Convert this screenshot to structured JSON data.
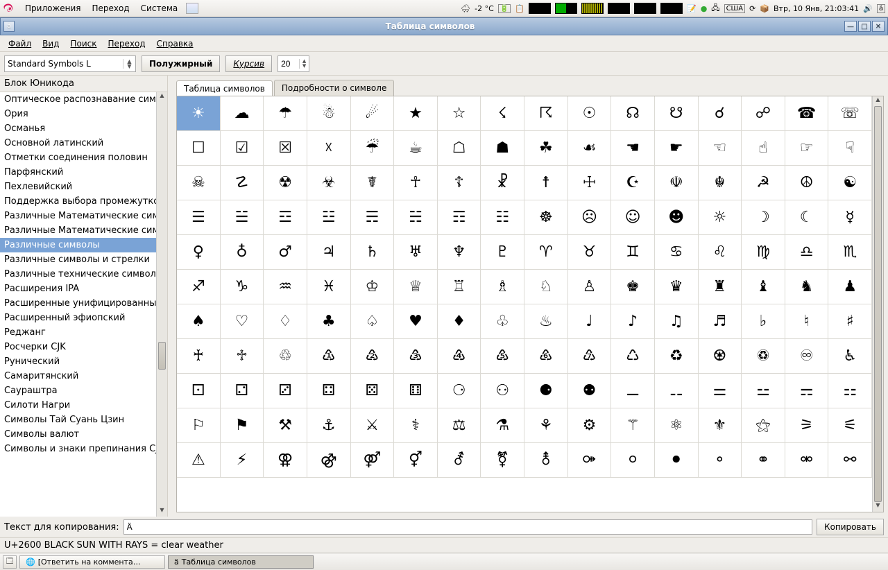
{
  "system_panel": {
    "menus": [
      "Приложения",
      "Переход",
      "Система"
    ],
    "weather": "-2 °C",
    "kbd_layout": "США",
    "clock": "Втр, 10 Янв, 21:03:41"
  },
  "window": {
    "title": "Таблица символов"
  },
  "menubar": {
    "items": [
      "Файл",
      "Вид",
      "Поиск",
      "Переход",
      "Справка"
    ]
  },
  "toolbar": {
    "font_family": "Standard Symbols L",
    "bold_label": "Полужирный",
    "italic_label": "Курсив",
    "size": "20"
  },
  "sidebar": {
    "header": "Блок Юникода",
    "items": [
      "Оптическое распознавание сим",
      "Ория",
      "Османья",
      "Основной латинский",
      "Отметки соединения половин",
      "Парфянский",
      "Пехлевийский",
      "Поддержка выбора промежутко",
      "Различные Математические сим",
      "Различные Математические сим",
      "Различные символы",
      "Различные символы и стрелки",
      "Различные технические символ",
      "Расширения IPA",
      "Расширенные унифицированные",
      "Расширенный эфиопский",
      "Реджанг",
      "Росчерки CJK",
      "Рунический",
      "Самаритянский",
      "Саураштра",
      "Силоти Нагри",
      "Символы Тай Суань Цзин",
      "Символы валют",
      "Символы и знаки препинания CJK"
    ],
    "selected_index": 10
  },
  "tabs": {
    "items": [
      "Таблица символов",
      "Подробности о символе"
    ],
    "active_index": 0
  },
  "chars": [
    "☀",
    "☁",
    "☂",
    "☃",
    "☄",
    "★",
    "☆",
    "☇",
    "☈",
    "☉",
    "☊",
    "☋",
    "☌",
    "☍",
    "☎",
    "☏",
    "☐",
    "☑",
    "☒",
    "☓",
    "☔",
    "☕",
    "☖",
    "☗",
    "☘",
    "☙",
    "☚",
    "☛",
    "☜",
    "☝",
    "☞",
    "☟",
    "☠",
    "☡",
    "☢",
    "☣",
    "☤",
    "☥",
    "☦",
    "☧",
    "☨",
    "☩",
    "☪",
    "☫",
    "☬",
    "☭",
    "☮",
    "☯",
    "☰",
    "☱",
    "☲",
    "☳",
    "☴",
    "☵",
    "☶",
    "☷",
    "☸",
    "☹",
    "☺",
    "☻",
    "☼",
    "☽",
    "☾",
    "☿",
    "♀",
    "♁",
    "♂",
    "♃",
    "♄",
    "♅",
    "♆",
    "♇",
    "♈",
    "♉",
    "♊",
    "♋",
    "♌",
    "♍",
    "♎",
    "♏",
    "♐",
    "♑",
    "♒",
    "♓",
    "♔",
    "♕",
    "♖",
    "♗",
    "♘",
    "♙",
    "♚",
    "♛",
    "♜",
    "♝",
    "♞",
    "♟",
    "♠",
    "♡",
    "♢",
    "♣",
    "♤",
    "♥",
    "♦",
    "♧",
    "♨",
    "♩",
    "♪",
    "♫",
    "♬",
    "♭",
    "♮",
    "♯",
    "♰",
    "♱",
    "♲",
    "♳",
    "♴",
    "♵",
    "♶",
    "♷",
    "♸",
    "♹",
    "♺",
    "♻",
    "♼",
    "♽",
    "♾",
    "♿",
    "⚀",
    "⚁",
    "⚂",
    "⚃",
    "⚄",
    "⚅",
    "⚆",
    "⚇",
    "⚈",
    "⚉",
    "⚊",
    "⚋",
    "⚌",
    "⚍",
    "⚎",
    "⚏",
    "⚐",
    "⚑",
    "⚒",
    "⚓",
    "⚔",
    "⚕",
    "⚖",
    "⚗",
    "⚘",
    "⚙",
    "⚚",
    "⚛",
    "⚜",
    "⚝",
    "⚞",
    "⚟",
    "⚠",
    "⚡",
    "⚢",
    "⚣",
    "⚤",
    "⚥",
    "⚦",
    "⚧",
    "⚨",
    "⚩",
    "⚪",
    "⚫",
    "⚬",
    "⚭",
    "⚮",
    "⚯"
  ],
  "selected_char_index": 0,
  "copy_row": {
    "label": "Текст для копирования:",
    "value": "Ä",
    "button": "Копировать"
  },
  "status": "U+2600 BLACK SUN WITH RAYS   = clear weather",
  "taskbar": {
    "items": [
      "[Ответить на коммента…",
      "Таблица символов"
    ],
    "active_index": 1
  }
}
